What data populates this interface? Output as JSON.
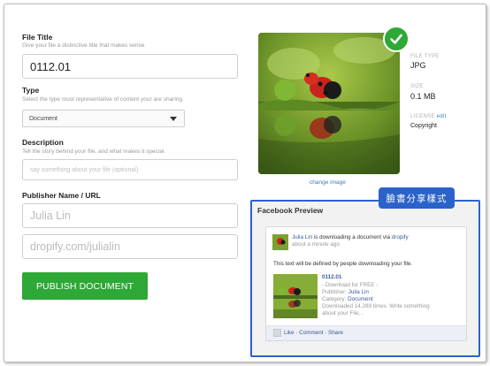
{
  "form": {
    "file_title": {
      "label": "File Title",
      "hint": "Give your file a distinctive title that makes sense.",
      "value": "0112.01"
    },
    "type": {
      "label": "Type",
      "hint": "Select the type most representative of content your are sharing.",
      "selected": "Document"
    },
    "description": {
      "label": "Description",
      "hint": "Tell the story behind your file, and what makes it special.",
      "placeholder": "say something about your file (optional)"
    },
    "publisher": {
      "label": "Publisher Name / URL",
      "name_placeholder": "Julia Lin",
      "url_placeholder": "dropify.com/julialin"
    },
    "publish_button": "PUBLISH DOCUMENT"
  },
  "file_meta": {
    "change_image": "change image",
    "file_type_label": "FILE TYPE",
    "file_type_value": "JPG",
    "size_label": "SIZE",
    "size_value": "0.1 MB",
    "license_label": "LICENSE",
    "license_edit": "edit",
    "license_value": "Copyright"
  },
  "annotation": {
    "tag": "臉書分享樣式"
  },
  "facebook_preview": {
    "title": "Facebook Preview",
    "user": "Julia Lin",
    "action_text": "is downloading a document via",
    "app": "dropify",
    "time": "about a minute ago",
    "message": "This text will be defined by people downloading your file.",
    "link_title": "0112.01",
    "link_subtitle": "- Download for FREE -",
    "publisher_label": "Publisher:",
    "publisher_value": "Julia Lin",
    "category_label": "Category:",
    "category_value": "Document",
    "downloads_line1": "Downloaded 14,289 times. Write something",
    "downloads_line2": "about your File...",
    "actions": "Like · Comment · Share"
  },
  "colors": {
    "accent_green": "#2ea836",
    "annotation_blue": "#2b62c9",
    "link_blue": "#3a7cc4",
    "facebook_blue": "#3b5998"
  },
  "icons": [
    "check-icon",
    "dropdown-caret-icon",
    "like-icon"
  ]
}
